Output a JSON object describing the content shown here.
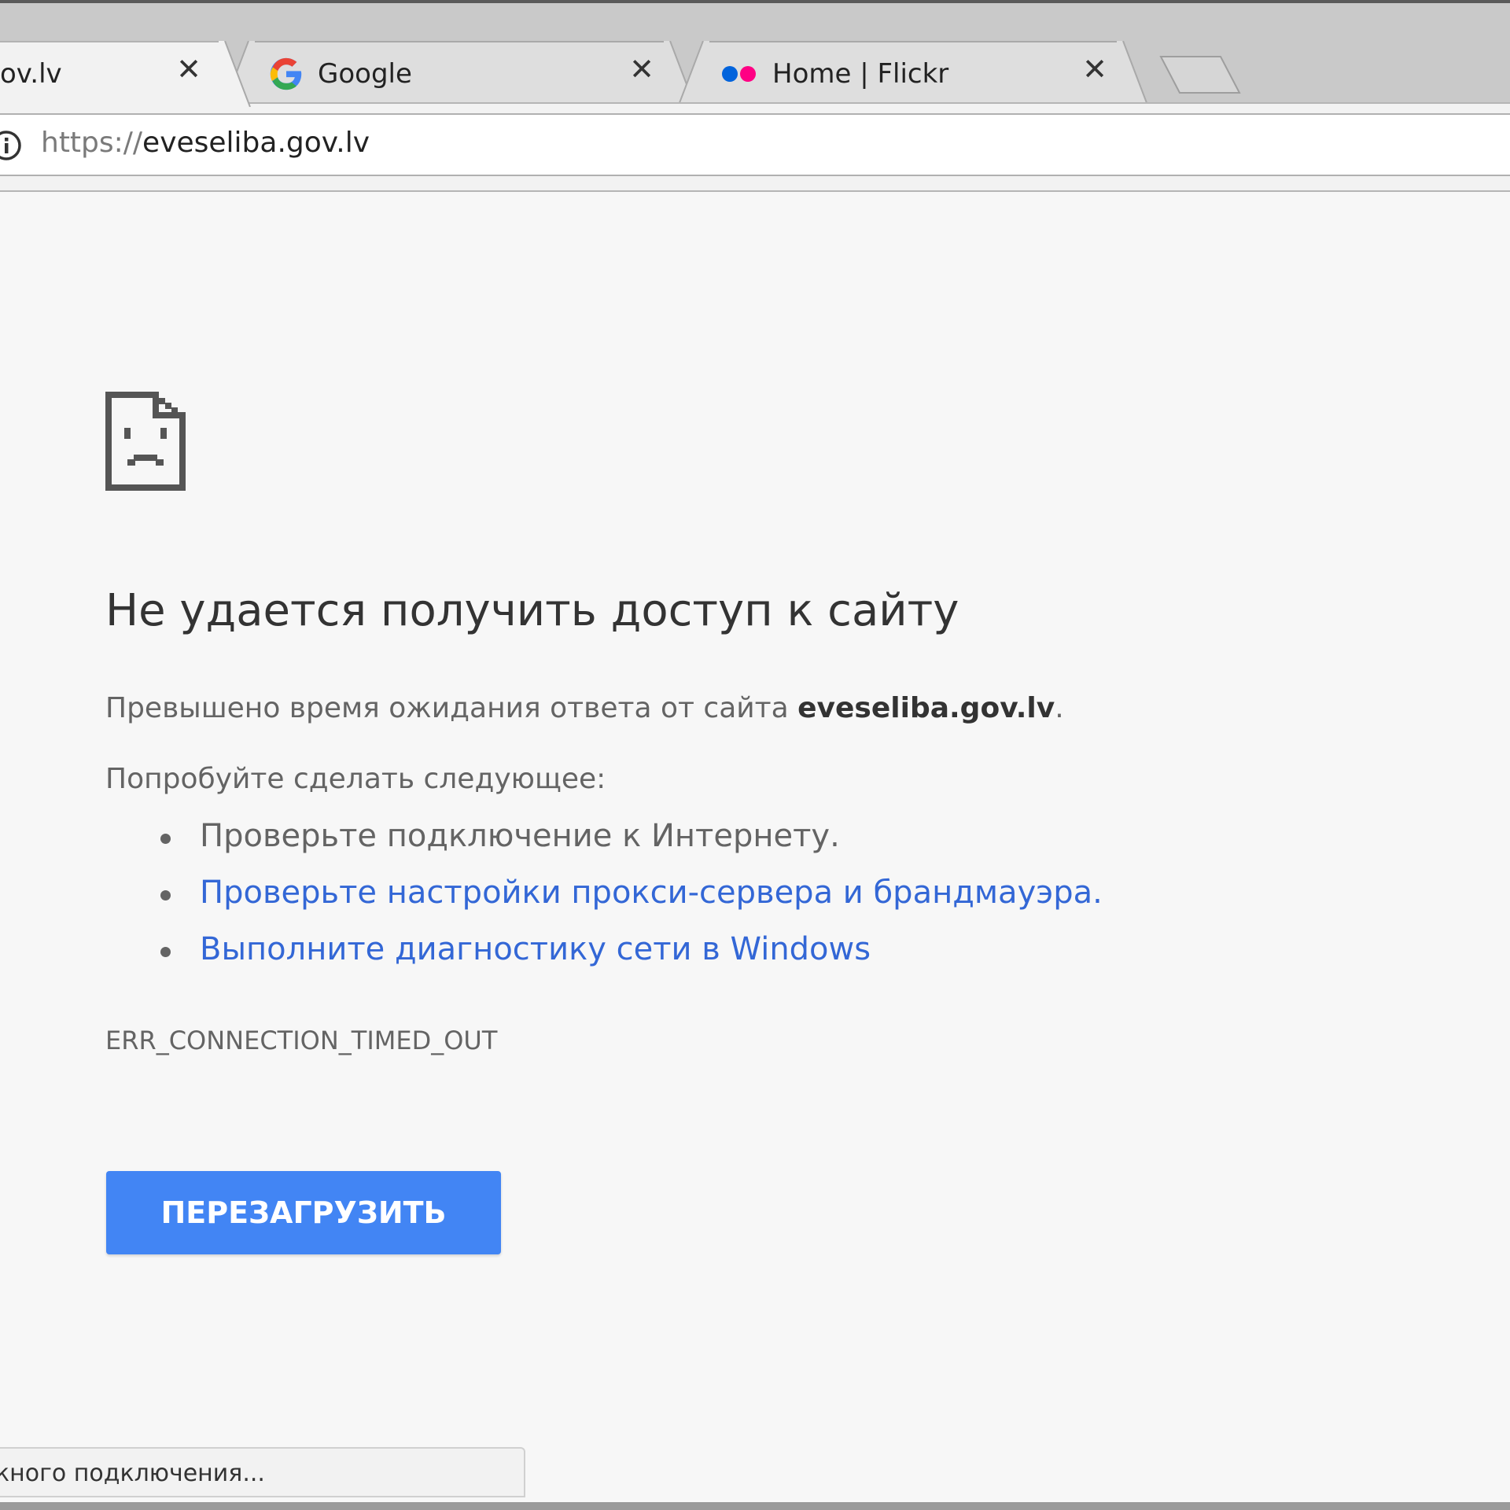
{
  "tabs": [
    {
      "title": "ov.lv",
      "active": true,
      "close_label": "✕"
    },
    {
      "title": "Google",
      "active": false,
      "close_label": "✕",
      "favicon": "google-g-icon"
    },
    {
      "title": "Home | Flickr",
      "active": false,
      "close_label": "✕",
      "favicon": "flickr-dots-icon"
    }
  ],
  "address_bar": {
    "scheme": "https://",
    "host": "eveseliba.gov.lv",
    "icon": "info-icon"
  },
  "error_page": {
    "icon": "sad-document-icon",
    "heading": "Не удается получить доступ к сайту",
    "summary_prefix": "Превышено время ожидания ответа от сайта ",
    "summary_host": "eveseliba.gov.lv",
    "summary_suffix": ".",
    "suggestions_intro": "Попробуйте сделать следующее:",
    "suggestions": [
      {
        "text": "Проверьте подключение к Интернету.",
        "link": false
      },
      {
        "text": "Проверьте настройки прокси-сервера и брандмауэра.",
        "link": true
      },
      {
        "text": "Выполните диагностику сети в Windows",
        "link": true
      }
    ],
    "error_code": "ERR_CONNECTION_TIMED_OUT",
    "reload_label": "ПЕРЕЗАГРУЗИТЬ"
  },
  "status_bar": {
    "text": "кного подключения..."
  },
  "colors": {
    "link": "#3367d6",
    "button": "#4285f4",
    "flickr_blue": "#0063dc",
    "flickr_pink": "#ff0084"
  }
}
